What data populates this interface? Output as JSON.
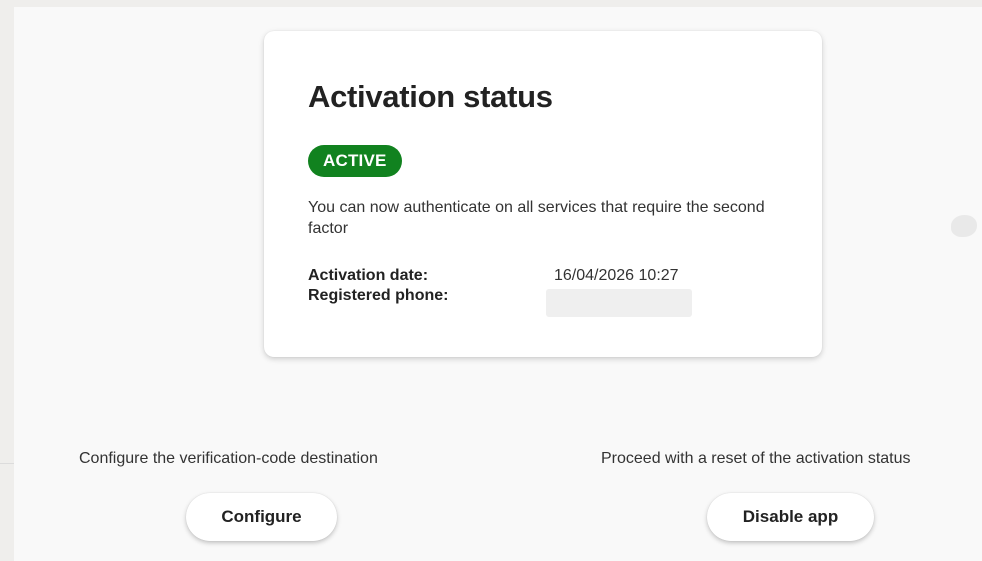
{
  "card": {
    "title": "Activation status",
    "status_badge": "ACTIVE",
    "description": "You can now authenticate on all services that require the second factor",
    "activation_date_label": "Activation date:",
    "activation_date_value": "16/04/2026 10:27",
    "registered_phone_label": "Registered phone:"
  },
  "actions": {
    "configure": {
      "description": "Configure the verification-code destination",
      "button_label": "Configure"
    },
    "disable": {
      "description": "Proceed with a reset of the activation status",
      "button_label": "Disable app"
    }
  },
  "colors": {
    "badge_green": "#11821f",
    "page_background": "#efeeec",
    "panel_background": "#f9f9f9"
  }
}
